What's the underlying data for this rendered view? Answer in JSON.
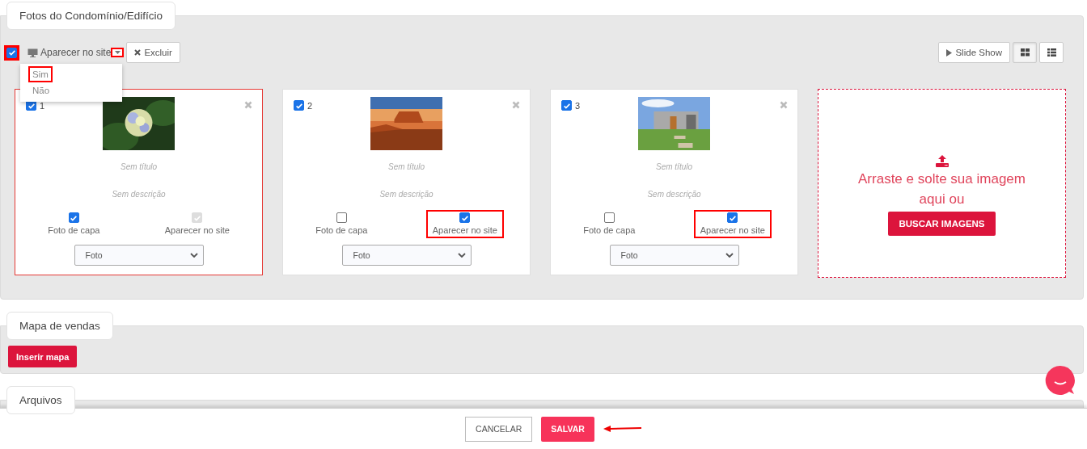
{
  "photos": {
    "tab": "Fotos do Condomínio/Edifício",
    "select_all": {
      "checked": true,
      "highlighted": true
    },
    "visibility_button": {
      "label": "Aparecer no site",
      "caret_highlighted": true
    },
    "delete_button": "Excluir",
    "dropdown": [
      {
        "label": "Sim",
        "highlighted": true
      },
      {
        "label": "Não",
        "highlighted": false
      }
    ],
    "slideshow_button": "Slide Show",
    "views": [
      {
        "kind": "grid",
        "selected": true
      },
      {
        "kind": "list",
        "selected": false
      }
    ],
    "cards": [
      {
        "number": "1",
        "checked": true,
        "selected": true,
        "title": "Sem título",
        "description": "Sem descrição",
        "cover": {
          "label": "Foto de capa",
          "checked": true
        },
        "site": {
          "label": "Aparecer no site",
          "checked": true,
          "disabled": true,
          "highlighted": false
        },
        "type": "Foto"
      },
      {
        "number": "2",
        "checked": true,
        "selected": false,
        "title": "Sem título",
        "description": "Sem descrição",
        "cover": {
          "label": "Foto de capa",
          "checked": false
        },
        "site": {
          "label": "Aparecer no site",
          "checked": true,
          "disabled": false,
          "highlighted": true
        },
        "type": "Foto"
      },
      {
        "number": "3",
        "checked": true,
        "selected": false,
        "title": "Sem título",
        "description": "Sem descrição",
        "cover": {
          "label": "Foto de capa",
          "checked": false
        },
        "site": {
          "label": "Aparecer no site",
          "checked": true,
          "disabled": false,
          "highlighted": true
        },
        "type": "Foto"
      }
    ],
    "upload": {
      "text": "Arraste e solte sua imagem aqui ou",
      "button": "BUSCAR IMAGENS"
    }
  },
  "map": {
    "tab": "Mapa de vendas",
    "button": "Inserir mapa"
  },
  "files": {
    "tab": "Arquivos"
  },
  "footer": {
    "cancel": "CANCELAR",
    "save": "SALVAR"
  }
}
